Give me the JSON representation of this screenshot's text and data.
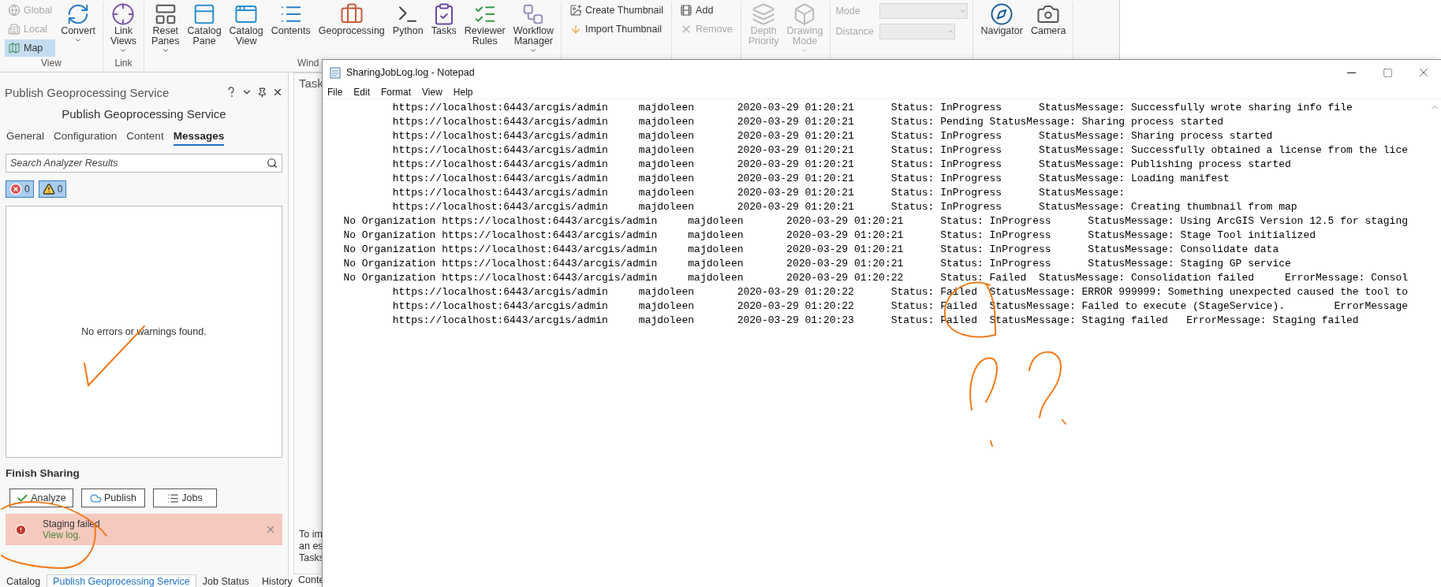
{
  "ribbon": {
    "groups": [
      {
        "label": "View",
        "items": [
          {
            "kind": "small",
            "label": "Global",
            "disabled": true,
            "selected": false
          },
          {
            "kind": "small",
            "label": "Local",
            "disabled": true,
            "selected": false
          },
          {
            "kind": "small",
            "label": "Map",
            "disabled": false,
            "selected": true
          },
          {
            "kind": "large",
            "lines": [
              "Convert"
            ],
            "dropdown": true,
            "disabled": false
          }
        ]
      },
      {
        "label": "Link",
        "items": [
          {
            "kind": "large",
            "lines": [
              "Link",
              "Views"
            ],
            "dropdown": true,
            "disabled": false
          }
        ]
      },
      {
        "label": "Wind",
        "items": [
          {
            "kind": "large",
            "lines": [
              "Reset",
              "Panes"
            ],
            "dropdown": true,
            "disabled": false
          },
          {
            "kind": "large",
            "lines": [
              "Catalog",
              "Pane"
            ],
            "dropdown": false,
            "disabled": false
          },
          {
            "kind": "large",
            "lines": [
              "Catalog",
              "View"
            ],
            "dropdown": false,
            "disabled": false
          },
          {
            "kind": "large",
            "lines": [
              "Contents"
            ],
            "dropdown": false,
            "disabled": false
          },
          {
            "kind": "large",
            "lines": [
              "Geoprocessing"
            ],
            "dropdown": false,
            "disabled": false
          },
          {
            "kind": "large",
            "lines": [
              "Python"
            ],
            "dropdown": false,
            "disabled": false
          },
          {
            "kind": "large",
            "lines": [
              "Tasks"
            ],
            "dropdown": false,
            "disabled": false
          },
          {
            "kind": "large",
            "lines": [
              "Reviewer",
              "Rules"
            ],
            "dropdown": false,
            "disabled": false
          },
          {
            "kind": "large",
            "lines": [
              "Workflow",
              "Manager"
            ],
            "dropdown": true,
            "disabled": false
          }
        ]
      },
      {
        "items": [
          {
            "kind": "small",
            "label": "Create Thumbnail",
            "disabled": false
          },
          {
            "kind": "small",
            "label": "Import Thumbnail",
            "disabled": false
          }
        ]
      },
      {
        "items": [
          {
            "kind": "small",
            "label": "Add",
            "disabled": false
          },
          {
            "kind": "small",
            "label": "Remove",
            "disabled": true
          }
        ]
      },
      {
        "items": [
          {
            "kind": "large",
            "lines": [
              "Depth",
              "Priority"
            ],
            "dropdown": false,
            "disabled": true
          },
          {
            "kind": "large",
            "lines": [
              "Drawing",
              "Mode"
            ],
            "dropdown": true,
            "disabled": true
          }
        ]
      },
      {
        "items": [
          {
            "kind": "combo",
            "label": "Mode",
            "disabled": true
          },
          {
            "kind": "spinner",
            "label": "Distance",
            "disabled": true
          }
        ]
      },
      {
        "items": [
          {
            "kind": "large",
            "lines": [
              "Navigator"
            ],
            "dropdown": false,
            "disabled": false
          },
          {
            "kind": "large",
            "lines": [
              "Camera"
            ],
            "dropdown": false,
            "disabled": false
          }
        ]
      }
    ]
  },
  "pane": {
    "title": "Publish Geoprocessing Service",
    "heading": "Publish Geoprocessing Service",
    "tabs": [
      {
        "label": "General",
        "selected": false
      },
      {
        "label": "Configuration",
        "selected": false
      },
      {
        "label": "Content",
        "selected": false
      },
      {
        "label": "Messages",
        "selected": true
      }
    ],
    "search": {
      "placeholder": "Search Analyzer Results"
    },
    "filters": [
      {
        "kind": "error",
        "count": "0",
        "selected": true
      },
      {
        "kind": "warning",
        "count": "0",
        "selected": true
      }
    ],
    "empty_message": "No errors or warnings found.",
    "section_title": "Finish Sharing",
    "buttons": [
      {
        "kind": "analyze",
        "label": "Analyze"
      },
      {
        "kind": "publish",
        "label": "Publish"
      },
      {
        "kind": "jobs",
        "label": "Jobs"
      }
    ],
    "alert": {
      "message": "Staging failed",
      "link": "View log."
    }
  },
  "bottom_tabs": [
    {
      "label": "Catalog",
      "selected": false
    },
    {
      "label": "Publish Geoprocessing Service",
      "selected": true
    },
    {
      "label": "Job Status",
      "selected": false
    },
    {
      "label": "History",
      "selected": false
    }
  ],
  "tasks_pane": {
    "title": "Task",
    "lines": [
      "To im",
      "an es",
      "Tasks"
    ],
    "bottom_tab": "Conte"
  },
  "notepad": {
    "title": "SharingJobLog.log - Notepad",
    "menu": [
      "File",
      "Edit",
      "Format",
      "View",
      "Help"
    ],
    "lines": [
      "           https://localhost:6443/arcgis/admin     majdoleen       2020-03-29 01:20:21      Status: InProgress      StatusMessage: Successfully wrote sharing info file",
      "           https://localhost:6443/arcgis/admin     majdoleen       2020-03-29 01:20:21      Status: Pending StatusMessage: Sharing process started",
      "           https://localhost:6443/arcgis/admin     majdoleen       2020-03-29 01:20:21      Status: InProgress      StatusMessage: Sharing process started",
      "           https://localhost:6443/arcgis/admin     majdoleen       2020-03-29 01:20:21      Status: InProgress      StatusMessage: Successfully obtained a license from the lice",
      "           https://localhost:6443/arcgis/admin     majdoleen       2020-03-29 01:20:21      Status: InProgress      StatusMessage: Publishing process started",
      "           https://localhost:6443/arcgis/admin     majdoleen       2020-03-29 01:20:21      Status: InProgress      StatusMessage: Loading manifest",
      "           https://localhost:6443/arcgis/admin     majdoleen       2020-03-29 01:20:21      Status: InProgress      StatusMessage:",
      "           https://localhost:6443/arcgis/admin     majdoleen       2020-03-29 01:20:21      Status: InProgress      StatusMessage: Creating thumbnail from map",
      "   No Organization https://localhost:6443/arcgis/admin     majdoleen       2020-03-29 01:20:21      Status: InProgress      StatusMessage: Using ArcGIS Version 12.5 for staging",
      "   No Organization https://localhost:6443/arcgis/admin     majdoleen       2020-03-29 01:20:21      Status: InProgress      StatusMessage: Stage Tool initialized",
      "   No Organization https://localhost:6443/arcgis/admin     majdoleen       2020-03-29 01:20:21      Status: InProgress      StatusMessage: Consolidate data",
      "   No Organization https://localhost:6443/arcgis/admin     majdoleen       2020-03-29 01:20:21      Status: InProgress      StatusMessage: Staging GP service",
      "   No Organization https://localhost:6443/arcgis/admin     majdoleen       2020-03-29 01:20:22      Status: Failed  StatusMessage: Consolidation failed     ErrorMessage: Consol",
      "           https://localhost:6443/arcgis/admin     majdoleen       2020-03-29 01:20:22      Status: Failed  StatusMessage: ERROR 999999: Something unexpected caused the tool to",
      "           https://localhost:6443/arcgis/admin     majdoleen       2020-03-29 01:20:22      Status: Failed  StatusMessage: Failed to execute (StageService).        ErrorMessage",
      "           https://localhost:6443/arcgis/admin     majdoleen       2020-03-29 01:20:23      Status: Failed  StatusMessage: Staging failed   ErrorMessage: Staging failed"
    ]
  }
}
